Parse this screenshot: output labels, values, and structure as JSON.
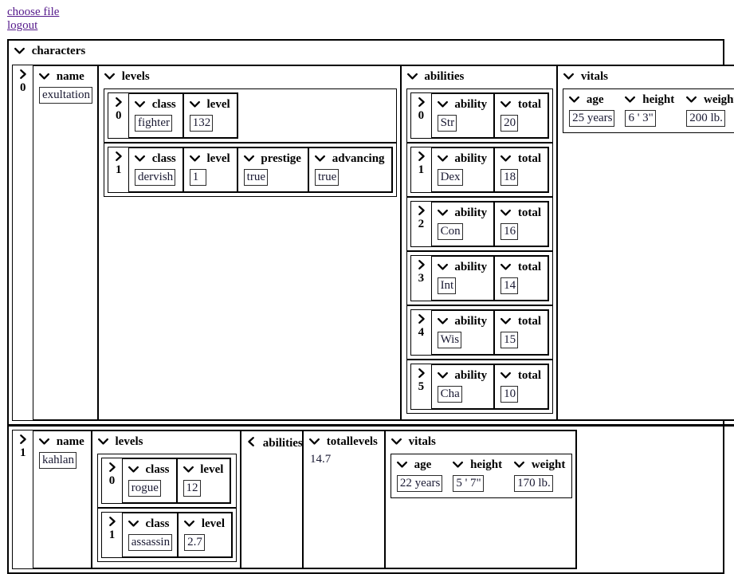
{
  "links": [
    {
      "label": "choose file",
      "name": "choose-file-link"
    },
    {
      "label": "logout",
      "name": "logout-link"
    }
  ],
  "root": {
    "label": "characters",
    "expanded": true
  },
  "field_labels": {
    "name": "name",
    "levels": "levels",
    "abilities": "abilities",
    "vitals": "vitals",
    "totallevels": "totallevels",
    "class": "class",
    "level": "level",
    "prestige": "prestige",
    "advancing": "advancing",
    "ability": "ability",
    "total": "total",
    "age": "age",
    "height": "height",
    "weight": "weight"
  },
  "indices": {
    "i0": "0",
    "i1": "1",
    "i2": "2",
    "i3": "3",
    "i4": "4",
    "i5": "5"
  },
  "records": [
    {
      "index": "0",
      "name": "exultation",
      "levels": [
        {
          "index": "0",
          "class": "fighter",
          "level": "132"
        },
        {
          "index": "1",
          "class": "dervish",
          "level": "1",
          "prestige": "true",
          "advancing": "true"
        }
      ],
      "abilities": [
        {
          "index": "0",
          "ability": "Str",
          "total": "20"
        },
        {
          "index": "1",
          "ability": "Dex",
          "total": "18"
        },
        {
          "index": "2",
          "ability": "Con",
          "total": "16"
        },
        {
          "index": "3",
          "ability": "Int",
          "total": "14"
        },
        {
          "index": "4",
          "ability": "Wis",
          "total": "15"
        },
        {
          "index": "5",
          "ability": "Cha",
          "total": "10"
        }
      ],
      "vitals": {
        "age": "25 years",
        "height": "6 ' 3\"",
        "weight": "200 lb."
      }
    },
    {
      "index": "1",
      "name": "kahlan",
      "levels": [
        {
          "index": "0",
          "class": "rogue",
          "level": "12"
        },
        {
          "index": "1",
          "class": "assassin",
          "level": "2.7"
        }
      ],
      "abilities_collapsed": true,
      "totallevels": "14.7",
      "vitals": {
        "age": "22 years",
        "height": "5 ' 7\"",
        "weight": "170 lb."
      }
    }
  ],
  "colors": {
    "link": "#551a8b",
    "border": "#000000",
    "value_text": "#1a1a33",
    "background": "#ffffff"
  }
}
